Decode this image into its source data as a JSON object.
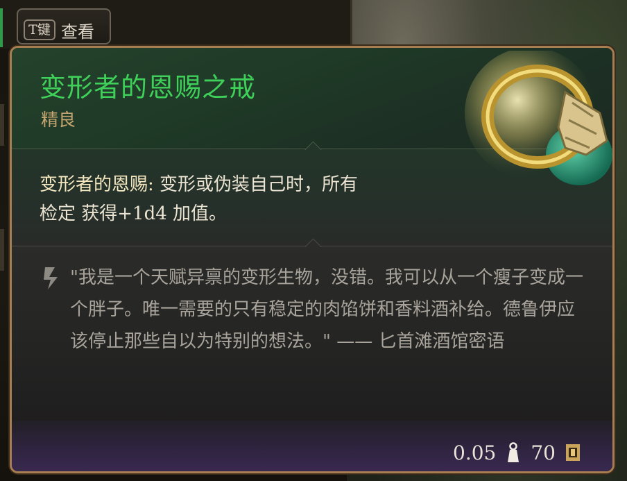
{
  "hotkey": {
    "key": "T键",
    "label": "查看"
  },
  "item": {
    "name": "变形者的恩赐之戒",
    "rarity": "精良",
    "description_prefix": "变形者的恩赐:",
    "description_body": " 变形或伪装自己时，所有",
    "description_line2": "检定 获得+1d4 加值。",
    "flavor_text": "\"我是一个天赋异禀的变形生物，没错。我可以从一个瘦子变成一个胖子。唯一需要的只有稳定的肉馅饼和香料酒补给。德鲁伊应该停止那些自以为特别的想法。\" —— 匕首滩酒馆密语",
    "weight": "0.05",
    "value": "70"
  },
  "icons": {
    "quote": "quote-icon",
    "weight": "weight-icon",
    "gold": "gold-coin-icon",
    "ring": "ring-icon"
  },
  "colors": {
    "title": "#3fd05a",
    "rarity": "#c6a570",
    "border": "#a77e52"
  }
}
